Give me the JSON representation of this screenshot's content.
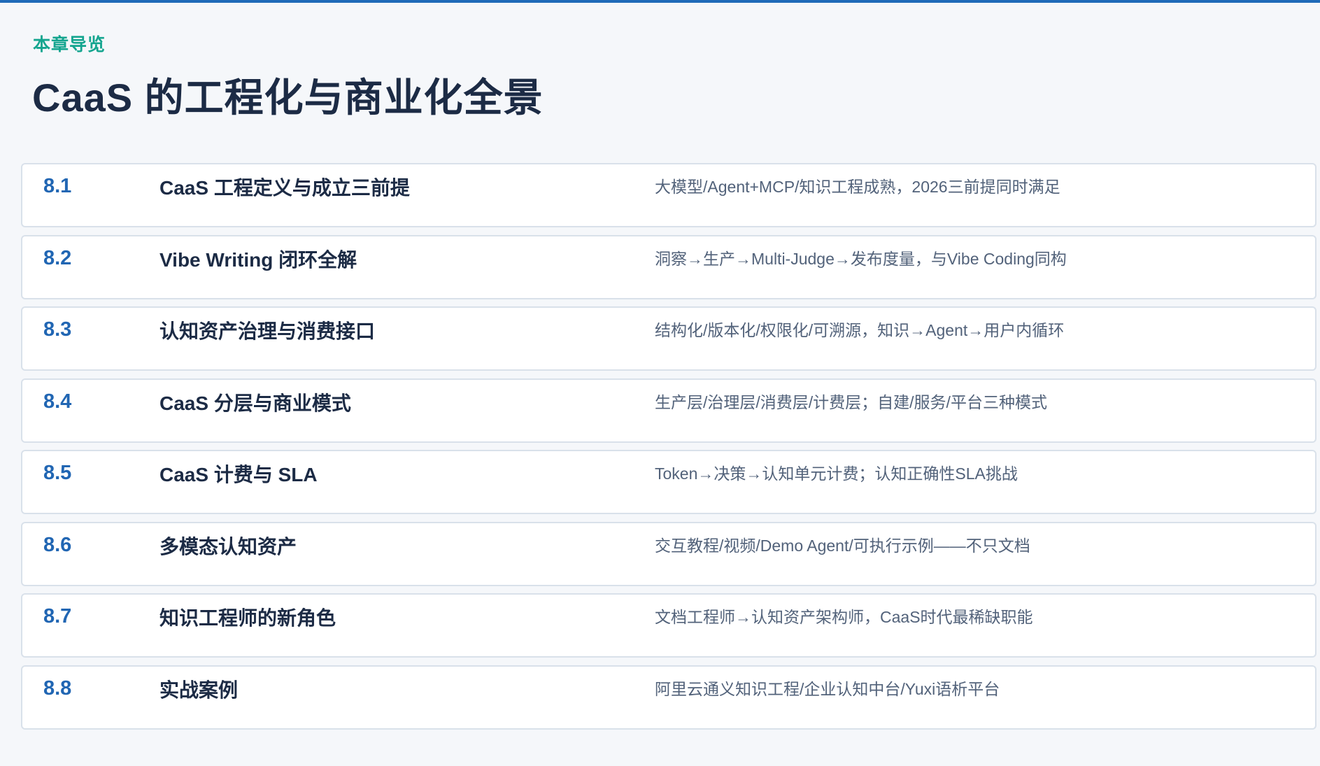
{
  "header": {
    "eyebrow": "本章导览",
    "title": "CaaS 的工程化与商业化全景"
  },
  "colors": {
    "accent_rule": "#1f6bb8",
    "eyebrow": "#14a58f",
    "number": "#2166b3",
    "title": "#1c2b45",
    "description": "#52627a",
    "background": "#f5f7fa",
    "card": "#ffffff"
  },
  "toc": [
    {
      "num": "8.1",
      "title": "CaaS 工程定义与成立三前提",
      "desc": "大模型/Agent+MCP/知识工程成熟，2026三前提同时满足"
    },
    {
      "num": "8.2",
      "title": "Vibe Writing 闭环全解",
      "desc": "洞察→生产→Multi-Judge→发布度量，与Vibe Coding同构"
    },
    {
      "num": "8.3",
      "title": "认知资产治理与消费接口",
      "desc": "结构化/版本化/权限化/可溯源，知识→Agent→用户内循环"
    },
    {
      "num": "8.4",
      "title": "CaaS 分层与商业模式",
      "desc": "生产层/治理层/消费层/计费层；自建/服务/平台三种模式"
    },
    {
      "num": "8.5",
      "title": "CaaS 计费与 SLA",
      "desc": "Token→决策→认知单元计费；认知正确性SLA挑战"
    },
    {
      "num": "8.6",
      "title": "多模态认知资产",
      "desc": "交互教程/视频/Demo Agent/可执行示例——不只文档"
    },
    {
      "num": "8.7",
      "title": "知识工程师的新角色",
      "desc": "文档工程师→认知资产架构师，CaaS时代最稀缺职能"
    },
    {
      "num": "8.8",
      "title": "实战案例",
      "desc": "阿里云通义知识工程/企业认知中台/Yuxi语析平台"
    }
  ]
}
